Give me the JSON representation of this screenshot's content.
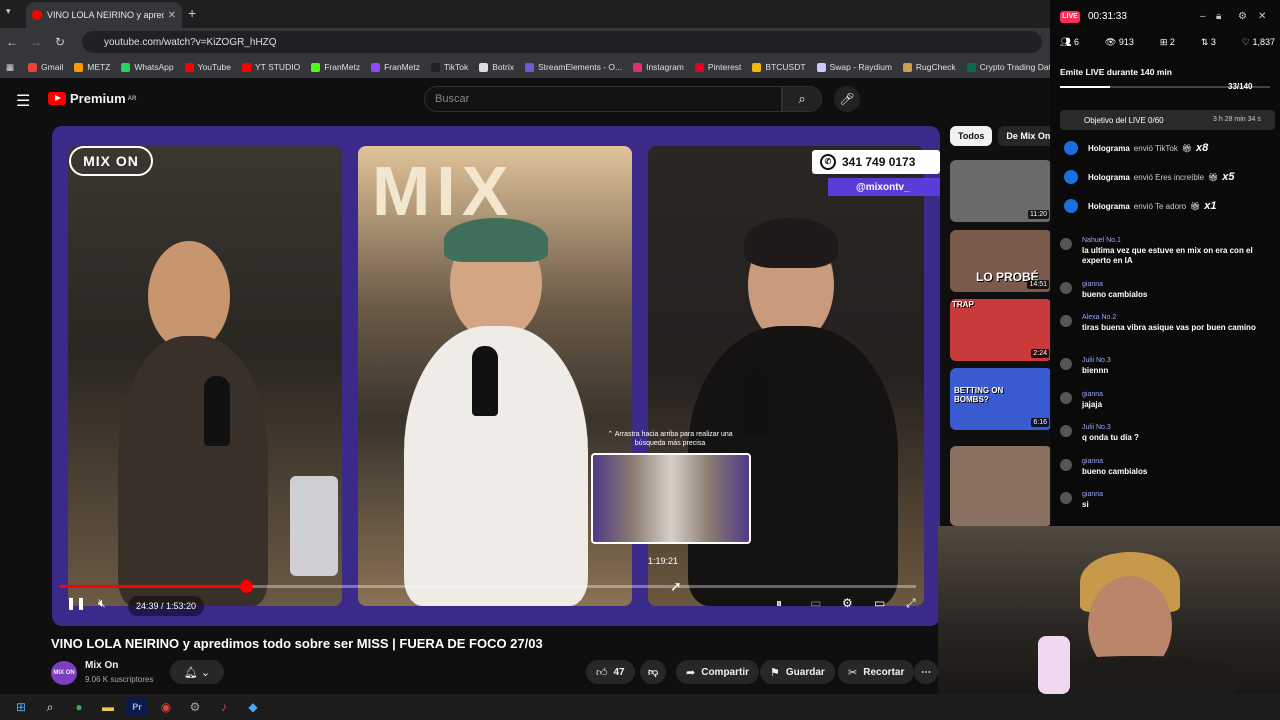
{
  "browser": {
    "tab_title": "VINO LOLA NEIRINO y apredimos",
    "url": "youtube.com/watch?v=KiZOGR_hHZQ",
    "bookmarks": [
      {
        "label": "Gmail",
        "color": "#ea4335"
      },
      {
        "label": "METZ",
        "color": "#ff9800"
      },
      {
        "label": "WhatsApp",
        "color": "#25d366"
      },
      {
        "label": "YouTube",
        "color": "#ff0000"
      },
      {
        "label": "YT STUDIO",
        "color": "#ff0000"
      },
      {
        "label": "FranMetz",
        "color": "#53fc18"
      },
      {
        "label": "FranMetz",
        "color": "#9146ff"
      },
      {
        "label": "TikTok",
        "color": "#222222"
      },
      {
        "label": "Botrix",
        "color": "#dddddd"
      },
      {
        "label": "StreamElements - O...",
        "color": "#6b5bd6"
      },
      {
        "label": "Instagram",
        "color": "#e1306c"
      },
      {
        "label": "Pinterest",
        "color": "#e60023"
      },
      {
        "label": "BTCUSDT",
        "color": "#f0b90b"
      },
      {
        "label": "Swap - Raydium",
        "color": "#c8c8ff"
      },
      {
        "label": "RugCheck",
        "color": "#c8a050"
      },
      {
        "label": "Crypto Trading Data...",
        "color": "#0b6b4b"
      }
    ]
  },
  "youtube": {
    "logo_label": "Premium",
    "logo_region": "AR",
    "search_placeholder": "Buscar"
  },
  "player": {
    "overlay_logo": "MIX ON",
    "whatsapp_number": "341 749 0173",
    "handle": "@mixontv_",
    "seek_hint": "Arrastra hacia arriba para realizar una búsqueda más precisa",
    "seek_time": "1:19:21",
    "current_time": "24:39",
    "duration": "1:53:20",
    "time_display": "24:39 / 1:53:20",
    "progress_fraction": 0.2175
  },
  "video": {
    "title": "VINO LOLA NEIRINO y apredimos todo sobre ser MISS | FUERA DE FOCO 27/03",
    "channel": "Mix On",
    "channel_avatar_text": "MIX ON",
    "subscribers": "9.06 K suscriptores",
    "likes": "47",
    "share_label": "Compartir",
    "save_label": "Guardar",
    "clip_label": "Recortar"
  },
  "related": {
    "chips": [
      "Todos",
      "De Mix On"
    ],
    "thumbs": [
      {
        "duration": "11:20",
        "text": "",
        "bg": "#6a6a6a"
      },
      {
        "duration": "14:51",
        "text": "LO PROBÉ",
        "bg": "#7a5a4a"
      },
      {
        "duration": "2:24",
        "text": "TRAP",
        "bg": "#c83a3a"
      },
      {
        "duration": "6:16",
        "text": "BETTING ON BOMBS?",
        "bg": "#3a5ad0"
      },
      {
        "duration": "",
        "text": "",
        "bg": "#8a7060"
      }
    ]
  },
  "stream": {
    "live_label": "LIVE",
    "live_time": "00:31:33",
    "stats": [
      "6",
      "913",
      "2",
      "3",
      "1,837"
    ],
    "emite_text": "Emite LIVE durante 140 min",
    "emite_count": "33/140",
    "emite_fraction": 0.236,
    "goal_text": "Objetivo del LIVE 0/60",
    "goal_time": "3 h 28 min 34 s",
    "gifts": [
      {
        "user": "Holograma",
        "action": "envió TikTok",
        "count": "x8"
      },
      {
        "user": "Holograma",
        "action": "envió Eres increíble",
        "count": "x5"
      },
      {
        "user": "Holograma",
        "action": "envió Te adoro",
        "count": "x1"
      }
    ],
    "chat": [
      {
        "user": "Nahuel No.1",
        "msg": "la ultima vez que estuve en mix on era con el experto en IA"
      },
      {
        "user": "gianna",
        "msg": "bueno cambialos"
      },
      {
        "user": "Alexa No.2",
        "msg": "tiras buena vibra asique vas por buen camino"
      },
      {
        "user": "Julii No.3",
        "msg": "biennn"
      },
      {
        "user": "gianna",
        "msg": "jajaja"
      },
      {
        "user": "Julii No.3",
        "msg": "q onda tu día ?"
      },
      {
        "user": "gianna",
        "msg": "bueno cambialos"
      },
      {
        "user": "gianna",
        "msg": "si"
      }
    ]
  }
}
